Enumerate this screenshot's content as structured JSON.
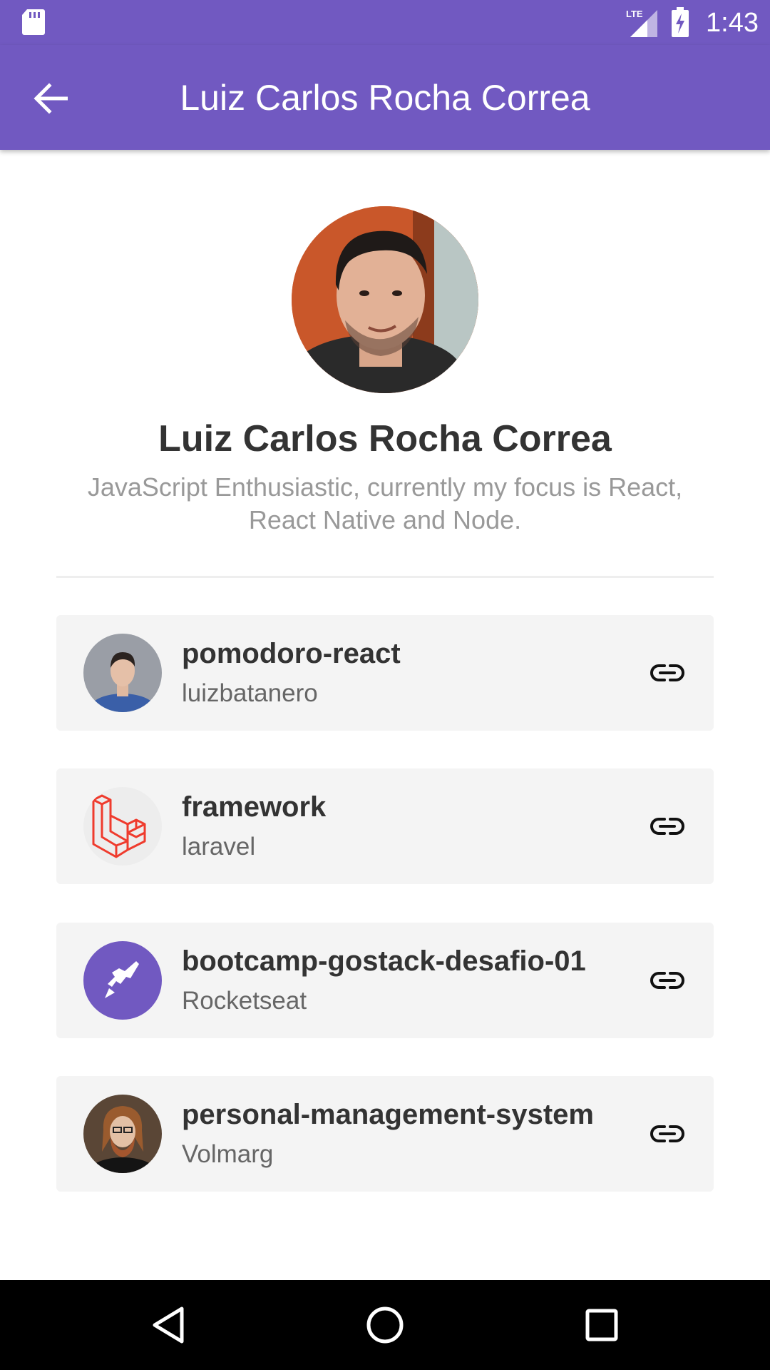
{
  "status_bar": {
    "time": "1:43",
    "network_label": "LTE",
    "icons": [
      "sd-card-icon",
      "signal-icon",
      "battery-charging-icon"
    ]
  },
  "app_bar": {
    "title": "Luiz Carlos Rocha Correa",
    "back_icon": "arrow-left-icon",
    "color": "#7159c1"
  },
  "profile": {
    "name": "Luiz Carlos Rocha Correa",
    "bio": "JavaScript Enthusiastic, currently my focus is React, React Native and Node."
  },
  "repositories": [
    {
      "title": "pomodoro-react",
      "owner": "luizbatanero",
      "link_icon": "link-icon"
    },
    {
      "title": "framework",
      "owner": "laravel",
      "link_icon": "link-icon"
    },
    {
      "title": "bootcamp-gostack-desafio-01",
      "owner": "Rocketseat",
      "link_icon": "link-icon"
    },
    {
      "title": "personal-management-system",
      "owner": "Volmarg",
      "link_icon": "link-icon"
    }
  ],
  "nav_bar": {
    "icons": [
      "back-triangle-icon",
      "home-circle-icon",
      "recents-square-icon"
    ]
  },
  "colors": {
    "primary": "#7159c1",
    "card_background": "#f4f4f4",
    "laravel_red": "#ef3b2d"
  }
}
